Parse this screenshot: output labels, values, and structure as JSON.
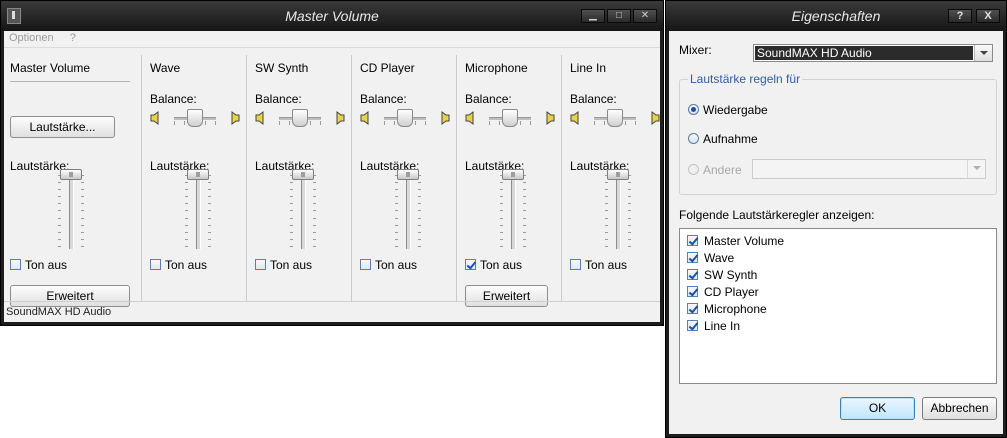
{
  "master_window": {
    "title": "Master Volume",
    "menu": [
      "Optionen",
      "?"
    ],
    "master": {
      "title": "Master Volume",
      "button": "Lautstärke...",
      "volume_label": "Lautstärke:",
      "mute_label": "Ton aus",
      "advanced_button": "Erweitert"
    },
    "channels": [
      {
        "title": "Wave",
        "balance_label": "Balance:",
        "volume_label": "Lautstärke:",
        "mute_label": "Ton aus",
        "muted": false
      },
      {
        "title": "SW Synth",
        "balance_label": "Balance:",
        "volume_label": "Lautstärke:",
        "mute_label": "Ton aus",
        "muted": false
      },
      {
        "title": "CD Player",
        "balance_label": "Balance:",
        "volume_label": "Lautstärke:",
        "mute_label": "Ton aus",
        "muted": false
      },
      {
        "title": "Microphone",
        "balance_label": "Balance:",
        "volume_label": "Lautstärke:",
        "mute_label": "Ton aus",
        "muted": true,
        "advanced_button": "Erweitert"
      },
      {
        "title": "Line In",
        "balance_label": "Balance:",
        "volume_label": "Lautstärke:",
        "mute_label": "Ton aus",
        "muted": false
      }
    ],
    "status": "SoundMAX HD Audio"
  },
  "properties_dialog": {
    "title": "Eigenschaften",
    "help_button": "?",
    "close_button": "X",
    "mixer_label": "Mixer:",
    "mixer_value": "SoundMAX HD Audio",
    "group_title": "Lautstärke regeln für",
    "radios": [
      {
        "label": "Wiedergabe",
        "checked": true,
        "disabled": false
      },
      {
        "label": "Aufnahme",
        "checked": false,
        "disabled": false
      },
      {
        "label": "Andere",
        "checked": false,
        "disabled": true
      }
    ],
    "list_label": "Folgende Lautstärkeregler anzeigen:",
    "list_items": [
      {
        "label": "Master Volume",
        "checked": true
      },
      {
        "label": "Wave",
        "checked": true
      },
      {
        "label": "SW Synth",
        "checked": true
      },
      {
        "label": "CD Player",
        "checked": true
      },
      {
        "label": "Microphone",
        "checked": true
      },
      {
        "label": "Line In",
        "checked": true
      }
    ],
    "ok_button": "OK",
    "cancel_button": "Abbrechen"
  }
}
